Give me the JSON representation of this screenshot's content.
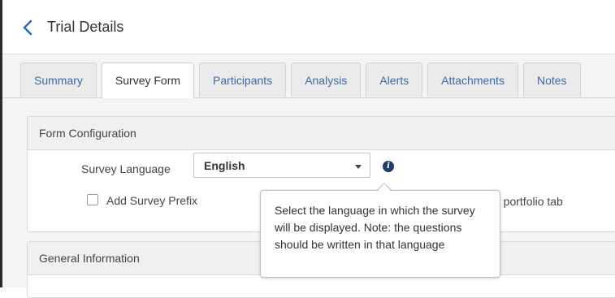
{
  "header": {
    "back_icon": "chevron-left-icon",
    "title": "Trial Details"
  },
  "tabs": [
    {
      "label": "Summary",
      "active": false
    },
    {
      "label": "Survey Form",
      "active": true
    },
    {
      "label": "Participants",
      "active": false
    },
    {
      "label": "Analysis",
      "active": false
    },
    {
      "label": "Alerts",
      "active": false
    },
    {
      "label": "Attachments",
      "active": false
    },
    {
      "label": "Notes",
      "active": false
    }
  ],
  "form_config": {
    "title": "Form Configuration",
    "language_label": "Survey Language",
    "language_value": "English",
    "info_icon": "info-icon",
    "prefix_label": "Add Survey Prefix",
    "prefix_checked": false,
    "hidden_text_fragment": "e portfolio tab"
  },
  "general_info": {
    "title": "General Information"
  },
  "tooltip": {
    "text": "Select the language in which the survey will be displayed. Note: the questions should be written in that language"
  },
  "colors": {
    "tab_link": "#3a6aa8",
    "info_icon_bg": "#1f3d6b",
    "back_icon": "#2f6db0"
  }
}
